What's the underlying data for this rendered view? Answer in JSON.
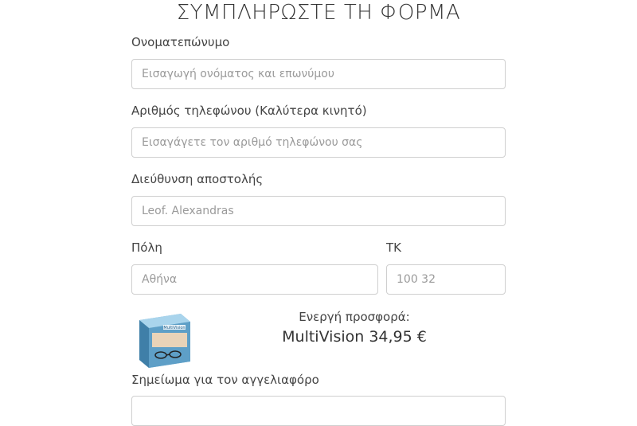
{
  "form": {
    "title": "ΣΥΜΠΛΗΡΩΣΤΕ ΤΗ ΦΟΡΜΑ",
    "fullname": {
      "label": "Ονοματεπώνυμο",
      "placeholder": "Εισαγωγή ονόματος και επωνύμου"
    },
    "phone": {
      "label": "Αριθμός τηλεφώνου (Καλύτερα κινητό)",
      "placeholder": "Εισαγάγετε τον αριθμό τηλεφώνου σας"
    },
    "address": {
      "label": "Διεύθυνση αποστολής",
      "placeholder": "Leof. Alexandras"
    },
    "city": {
      "label": "Πόλη",
      "placeholder": "Αθήνα"
    },
    "zip": {
      "label": "ΤΚ",
      "placeholder": "100 32"
    },
    "notes": {
      "label": "Σημείωμα για τον αγγελιαφόρο"
    }
  },
  "offer": {
    "heading": "Ενεργή προσφορά:",
    "product_price": "MultiVision 34,95 €",
    "box_brand": "MultiVision"
  },
  "colors": {
    "input_border": "#cfcfcf",
    "text": "#333333",
    "placeholder": "#9a9a9a"
  }
}
